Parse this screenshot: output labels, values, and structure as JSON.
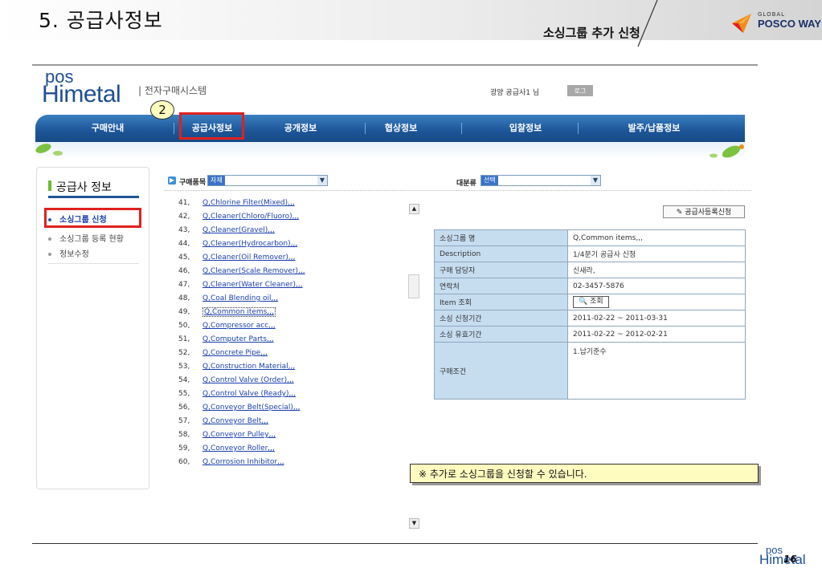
{
  "slide": {
    "title": "5. 공급사정보",
    "subtitle": "소싱그룹 추가 신청",
    "brand_global": "GLOBAL",
    "brand_name": "POSCO WAY",
    "page_number": "16"
  },
  "app": {
    "logo_top": "pos",
    "logo_main": "Himetal",
    "system_name": "| 전자구매시스템",
    "user_greeting": "광양 공급사1 님",
    "logout_label": "로그아웃"
  },
  "nav": {
    "items": [
      "구매안내",
      "공급사정보",
      "공개정보",
      "협상정보",
      "입찰정보",
      "발주/납품정보"
    ],
    "active_index": 1
  },
  "step_badge": "2",
  "sidebar": {
    "title": "공급사 정보",
    "items": [
      "소싱그룹 신청",
      "소싱그룹 등록 현황",
      "정보수정"
    ],
    "active_index": 0
  },
  "filter": {
    "purchase_item_label": "구매품목",
    "purchase_item_value": "자재",
    "category_label": "대분류",
    "category_value": "선택"
  },
  "group_list": [
    {
      "num": "41,",
      "name": "Q,Chlorine Filter(Mixed),,,"
    },
    {
      "num": "42,",
      "name": "Q,Cleaner(Chloro/Fluoro),,,"
    },
    {
      "num": "43,",
      "name": "Q,Cleaner(Gravel),,,"
    },
    {
      "num": "44,",
      "name": "Q,Cleaner(Hydrocarbon),,,"
    },
    {
      "num": "45,",
      "name": "Q,Cleaner(Oil Remover),,,"
    },
    {
      "num": "46,",
      "name": "Q,Cleaner(Scale Remover),,,"
    },
    {
      "num": "47,",
      "name": "Q,Cleaner(Water Cleaner),,,"
    },
    {
      "num": "48,",
      "name": "Q,Coal Blending oil,,,"
    },
    {
      "num": "49,",
      "name": "Q,Common items,,,"
    },
    {
      "num": "50,",
      "name": "Q,Compressor acc,,,"
    },
    {
      "num": "51,",
      "name": "Q,Computer Parts,,,"
    },
    {
      "num": "52,",
      "name": "Q,Concrete Pipe,,,"
    },
    {
      "num": "53,",
      "name": "Q,Construction Material,,,"
    },
    {
      "num": "54,",
      "name": "Q,Control Valve (Order),,,"
    },
    {
      "num": "55,",
      "name": "Q,Control Valve (Ready),,,"
    },
    {
      "num": "56,",
      "name": "Q,Conveyor Belt(Special),,,"
    },
    {
      "num": "57,",
      "name": "Q,Conveyor Belt,,,"
    },
    {
      "num": "58,",
      "name": "Q,Conveyor Pulley,,,"
    },
    {
      "num": "59,",
      "name": "Q,Conveyor Roller,,,"
    },
    {
      "num": "60,",
      "name": "Q,Corrosion Inhibitor,,,"
    }
  ],
  "selected_list_index": 8,
  "register_button": "공급사등록신청",
  "detail": {
    "group_name_label": "소싱그룹 명",
    "group_name_value": "Q,Common items,,,",
    "description_label": "Description",
    "description_value": "1/4분기 공급사 신청",
    "manager_label": "구매 담당자",
    "manager_value": "신새라,",
    "contact_label": "연락처",
    "contact_value": "02-3457-5876",
    "item_lookup_label": "Item 조회",
    "item_lookup_button": "조회",
    "apply_period_label": "소싱 신청기간",
    "apply_period_value": "2011-02-22  ~  2011-03-31",
    "valid_period_label": "소싱 유효기간",
    "valid_period_value": "2011-02-22  ~  2012-02-21",
    "condition_label": "구매조건",
    "condition_value": "1.납기준수"
  },
  "notice": "※ 추가로 소싱그룹을 신청할 수 있습니다."
}
